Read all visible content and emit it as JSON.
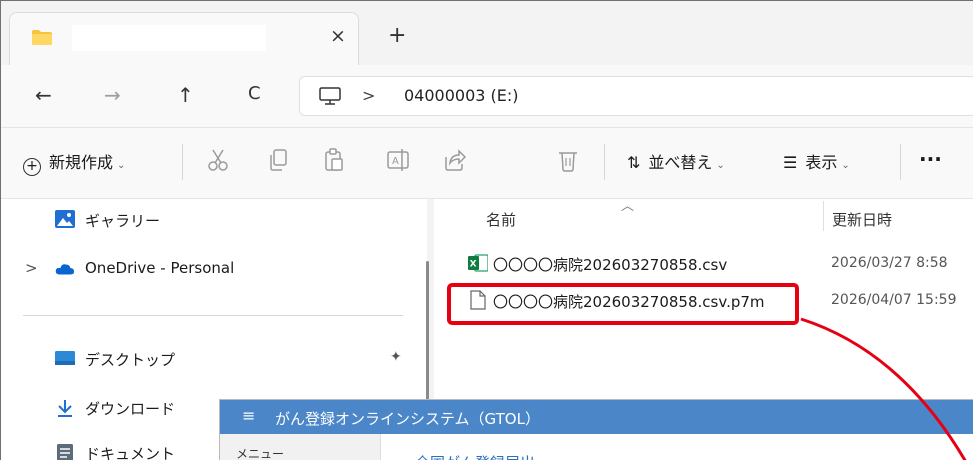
{
  "tabs": [
    {
      "title": "",
      "close_glyph": "×"
    }
  ],
  "new_tab_glyph": "+",
  "nav": {
    "back": "←",
    "forward": "→",
    "up": "↑",
    "refresh": "C"
  },
  "address": {
    "separator": ">",
    "drive": "04000003 (E:)"
  },
  "toolbar": {
    "new_label": "新規作成",
    "sort_label": "並べ替え",
    "view_label": "表示",
    "more": "...",
    "chevron": "⌄"
  },
  "sidebar": {
    "items": [
      {
        "label": "ギャラリー",
        "icon": "gallery-icon"
      },
      {
        "label": "OneDrive - Personal",
        "icon": "onedrive-icon"
      },
      {
        "label": "デスクトップ",
        "icon": "desktop-icon"
      },
      {
        "label": "ダウンロード",
        "icon": "download-icon"
      },
      {
        "label": "ドキュメント",
        "icon": "document-icon"
      }
    ],
    "expand_glyph": ">",
    "pin_glyph": "✦"
  },
  "columns": {
    "name": "名前",
    "modified": "更新日時"
  },
  "files": [
    {
      "name": "〇〇〇〇病院202603270858.csv",
      "modified": "2026/03/27 8:58",
      "icon": "excel-csv-icon"
    },
    {
      "name": "〇〇〇〇病院202603270858.csv.p7m",
      "modified": "2026/04/07 15:59",
      "icon": "generic-file-icon"
    }
  ],
  "gtol": {
    "menu_icon": "≡",
    "title": "がん登録オンラインシステム（GTOL）",
    "side_label": "メニュー",
    "body_text": "全国がん登録届出"
  },
  "colors": {
    "highlight": "#e60012",
    "gtol_bar": "#4a86c8"
  }
}
